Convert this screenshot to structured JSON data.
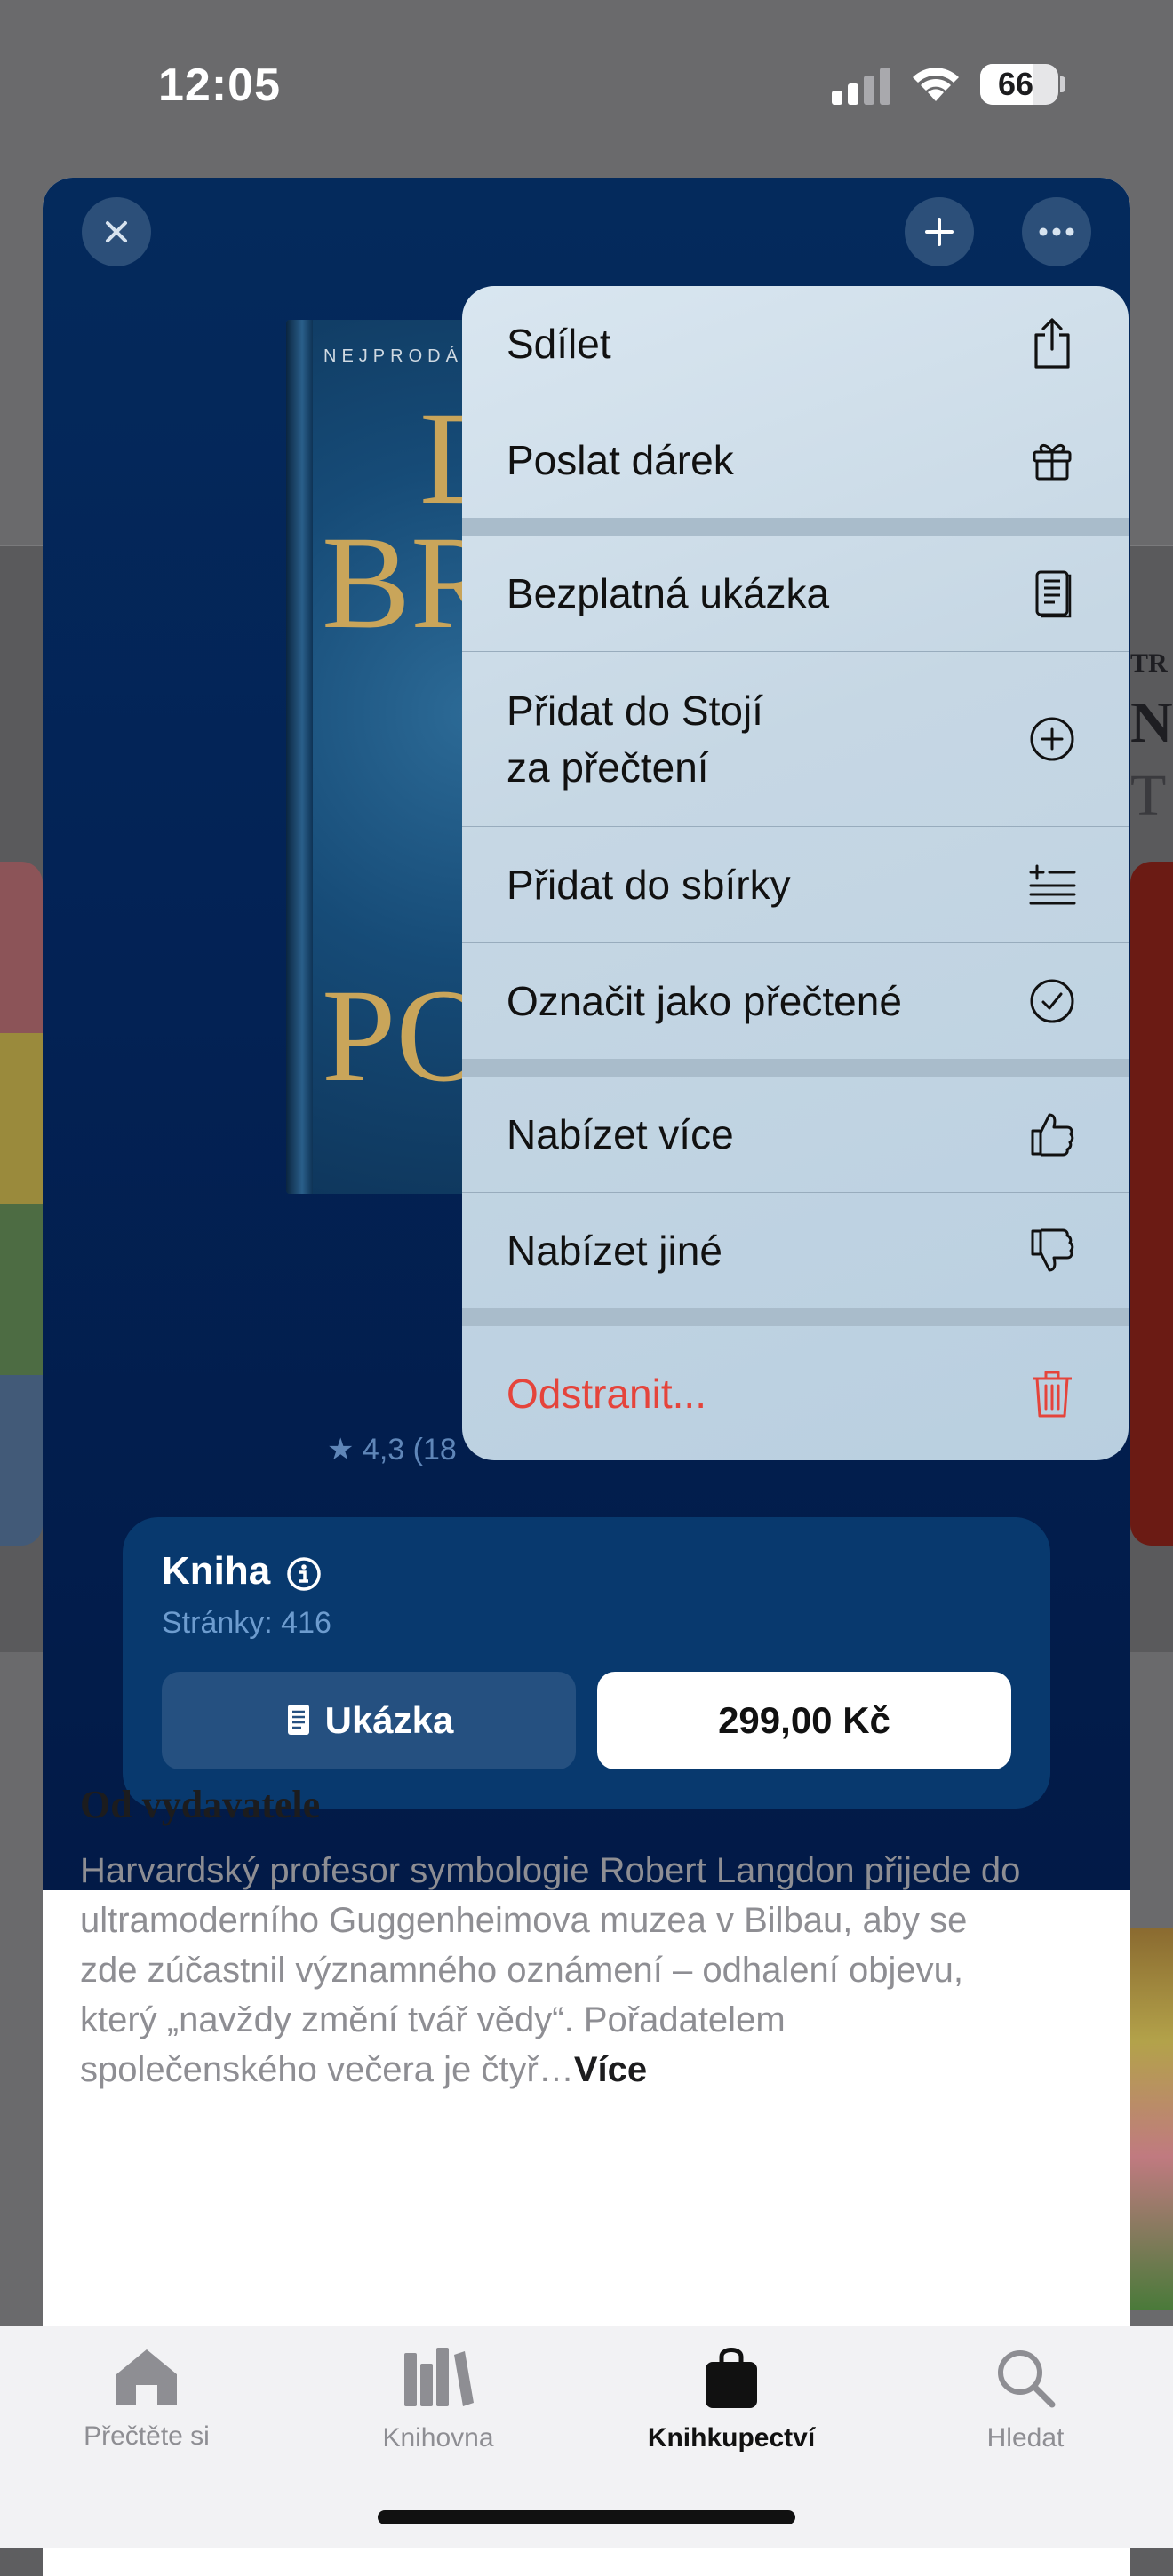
{
  "status_bar": {
    "time": "12:05",
    "battery": "66"
  },
  "sheet": {
    "book_cover": {
      "top_text": "NEJPRODÁ",
      "line1": "D",
      "line2": "BR",
      "line3": "PO"
    },
    "rating": "★ 4,3 (18",
    "buy_card": {
      "title": "Kniha",
      "pages": "Stránky: 416",
      "sample_label": "Ukázka",
      "price_label": "299,00 Kč"
    },
    "publisher": {
      "title": "Od vydavatele",
      "text": "Harvardský profesor symbologie Robert Langdon přijede do ultramoderního Guggenheimova muzea v Bilbau, aby se zde zúčastnil významného oznámení – odhalení objevu, který „navždy změní tvář vědy“. Pořadatelem společenského večera je čtyř…",
      "more": "Více"
    }
  },
  "background": {
    "right_text_1": "TR",
    "right_text_2": "N",
    "right_text_3": "T"
  },
  "menu": {
    "items": [
      {
        "label": "Sdílet",
        "icon": "share-icon"
      },
      {
        "label": "Poslat dárek",
        "icon": "gift-icon"
      },
      {
        "label": "Bezplatná ukázka",
        "icon": "sample-book-icon"
      },
      {
        "label_line1": "Přidat do Stojí",
        "label_line2": "za přečtení",
        "icon": "plus-circle-icon"
      },
      {
        "label": "Přidat do sbírky",
        "icon": "add-list-icon"
      },
      {
        "label": "Označit jako přečtené",
        "icon": "checkmark-circle-icon"
      },
      {
        "label": "Nabízet více",
        "icon": "thumbs-up-icon"
      },
      {
        "label": "Nabízet jiné",
        "icon": "thumbs-down-icon"
      },
      {
        "label": "Odstranit...",
        "icon": "trash-icon",
        "color": "#e5443b"
      }
    ]
  },
  "tabbar": {
    "tabs": [
      {
        "label": "Přečtěte si",
        "icon": "home-icon"
      },
      {
        "label": "Knihovna",
        "icon": "library-icon"
      },
      {
        "label": "Knihkupectví",
        "icon": "bag-icon",
        "active": true
      },
      {
        "label": "Hledat",
        "icon": "search-icon"
      }
    ]
  },
  "colors": {
    "accent_dark": "#042a5c",
    "destructive": "#e5443b"
  }
}
